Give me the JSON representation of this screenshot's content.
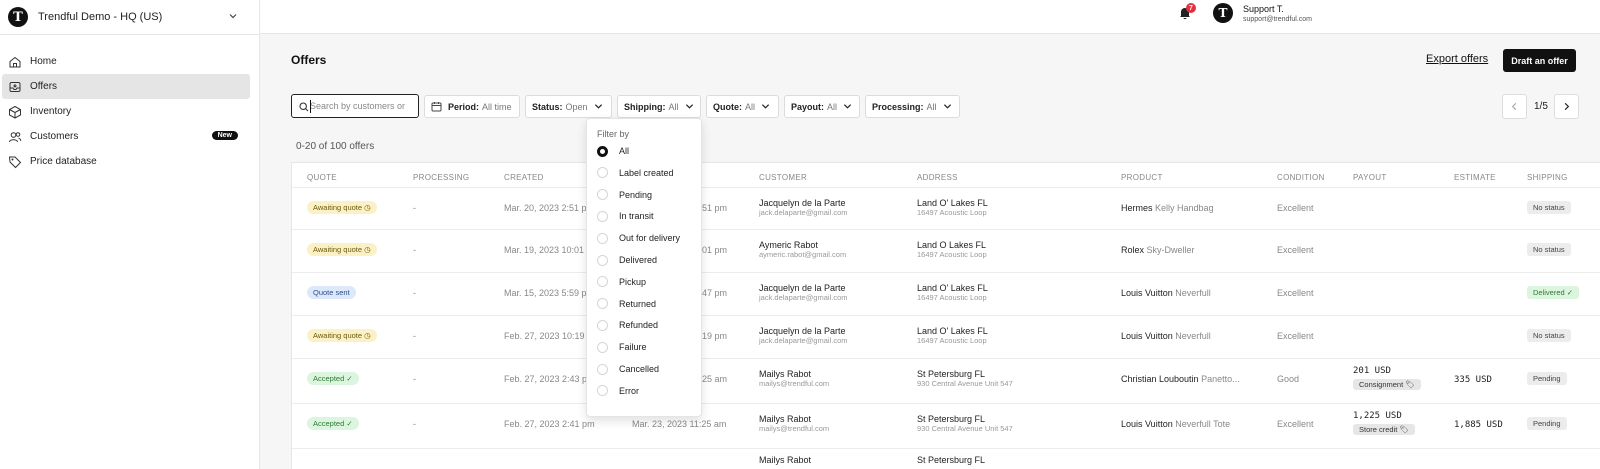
{
  "workspace": {
    "name": "Trendful Demo - HQ (US)",
    "logo": "T"
  },
  "nav": [
    {
      "label": "Home",
      "icon": "home-icon",
      "active": false
    },
    {
      "label": "Offers",
      "icon": "inbox-icon",
      "active": true
    },
    {
      "label": "Inventory",
      "icon": "box-icon",
      "active": false
    },
    {
      "label": "Customers",
      "icon": "users-icon",
      "active": false,
      "badge": "New"
    },
    {
      "label": "Price database",
      "icon": "tag-icon",
      "active": false
    }
  ],
  "header": {
    "notifications": "7",
    "user_initial": "T",
    "user_name": "Support T.",
    "user_email": "support@trendful.com"
  },
  "page": {
    "title": "Offers",
    "export_label": "Export offers",
    "draft_label": "Draft an offer",
    "search_placeholder": "Search by customers or",
    "count_text": "0-20 of 100 offers",
    "pager": "1/5"
  },
  "filters": [
    {
      "label": "Period:",
      "value": "All time"
    },
    {
      "label": "Status:",
      "value": "Open"
    },
    {
      "label": "Shipping:",
      "value": "All"
    },
    {
      "label": "Quote:",
      "value": "All"
    },
    {
      "label": "Payout:",
      "value": "All"
    },
    {
      "label": "Processing:",
      "value": "All"
    }
  ],
  "dropdown": {
    "title": "Filter by",
    "options": [
      "All",
      "Label created",
      "Pending",
      "In transit",
      "Out for delivery",
      "Delivered",
      "Pickup",
      "Returned",
      "Refunded",
      "Failure",
      "Cancelled",
      "Error"
    ],
    "selected": "All"
  },
  "columns": [
    "QUOTE",
    "PROCESSING",
    "CREATED",
    "CUSTOMER",
    "ADDRESS",
    "PRODUCT",
    "CONDITION",
    "PAYOUT",
    "ESTIMATE",
    "SHIPPING"
  ],
  "rows": [
    {
      "quote": "Awaiting quote ◷",
      "quote_style": "await",
      "processing": "-",
      "created": "Mar. 20, 2023 2:51 p",
      "updated": "51 pm",
      "customer": "Jacquelyn de la Parte",
      "email": "jack.delaparte@gmail.com",
      "city": "Land O' Lakes FL",
      "street": "16497 Acoustic Loop",
      "brand": "Hermes",
      "model": "Kelly Handbag",
      "condition": "Excellent",
      "payout": "",
      "payout_tag": "",
      "estimate": "",
      "shipping": "No status",
      "shipping_style": "ship"
    },
    {
      "quote": "Awaiting quote ◷",
      "quote_style": "await",
      "processing": "-",
      "created": "Mar. 19, 2023 10:01",
      "updated": "01 pm",
      "customer": "Aymeric Rabot",
      "email": "aymeric.rabot@gmail.com",
      "city": "Land O Lakes FL",
      "street": "16497 Acoustic Loop",
      "brand": "Rolex",
      "model": "Sky-Dweller",
      "condition": "Excellent",
      "payout": "",
      "payout_tag": "",
      "estimate": "",
      "shipping": "No status",
      "shipping_style": "ship"
    },
    {
      "quote": "Quote sent",
      "quote_style": "sent",
      "processing": "-",
      "created": "Mar. 15, 2023 5:59 p",
      "updated": "47 pm",
      "customer": "Jacquelyn de la Parte",
      "email": "jack.delaparte@gmail.com",
      "city": "Land O' Lakes FL",
      "street": "16497 Acoustic Loop",
      "brand": "Louis Vuitton",
      "model": "Neverfull",
      "condition": "Excellent",
      "payout": "",
      "payout_tag": "",
      "estimate": "",
      "shipping": "Delivered ✓",
      "shipping_style": "deliv"
    },
    {
      "quote": "Awaiting quote ◷",
      "quote_style": "await",
      "processing": "-",
      "created": "Feb. 27, 2023 10:19",
      "updated": "19 pm",
      "customer": "Jacquelyn de la Parte",
      "email": "jack.delaparte@gmail.com",
      "city": "Land O' Lakes FL",
      "street": "16497 Acoustic Loop",
      "brand": "Louis Vuitton",
      "model": "Neverfull",
      "condition": "Excellent",
      "payout": "",
      "payout_tag": "",
      "estimate": "",
      "shipping": "No status",
      "shipping_style": "ship"
    },
    {
      "quote": "Accepted ✓",
      "quote_style": "acc",
      "processing": "-",
      "created": "Feb. 27, 2023 2:43 p",
      "updated": "25 am",
      "customer": "Mailys Rabot",
      "email": "mailys@trendful.com",
      "city": "St Petersburg FL",
      "street": "930 Central Avenue Unit 547",
      "brand": "Christian Louboutin",
      "model": "Panetto...",
      "condition": "Good",
      "payout": "201 USD",
      "payout_tag": "Consignment 🏷",
      "estimate": "335 USD",
      "shipping": "Pending",
      "shipping_style": "ship"
    },
    {
      "quote": "Accepted ✓",
      "quote_style": "acc",
      "processing": "-",
      "created": "Feb. 27, 2023 2:41 pm",
      "updated": "Mar. 23, 2023 11:25 am",
      "customer": "Mailys Rabot",
      "email": "mailys@trendful.com",
      "city": "St Petersburg FL",
      "street": "930 Central Avenue Unit 547",
      "brand": "Louis Vuitton",
      "model": "Neverfull Tote",
      "condition": "Excellent",
      "payout": "1,225 USD",
      "payout_tag": "Store credit 🏷",
      "estimate": "1,885 USD",
      "shipping": "Pending",
      "shipping_style": "ship"
    },
    {
      "quote": "",
      "quote_style": "",
      "processing": "",
      "created": "",
      "updated": "",
      "customer": "Mailys Rabot",
      "email": "",
      "city": "St Petersburg FL",
      "street": "",
      "brand": "",
      "model": "",
      "condition": "",
      "payout": "",
      "payout_tag": "",
      "estimate": "",
      "shipping": "",
      "shipping_style": ""
    }
  ]
}
